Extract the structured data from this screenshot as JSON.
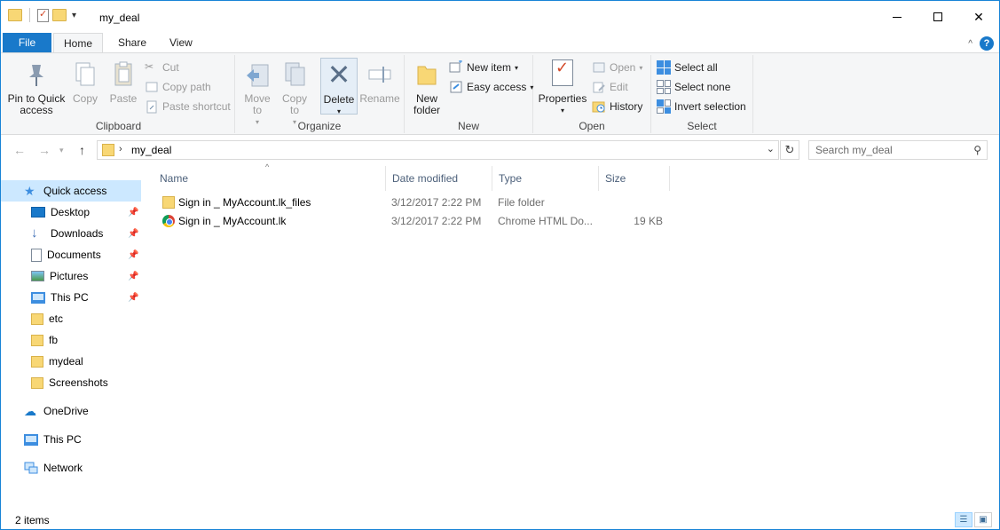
{
  "window": {
    "title": "my_deal"
  },
  "ribbon": {
    "tabs": [
      "File",
      "Home",
      "Share",
      "View"
    ],
    "clipboard": {
      "label": "Clipboard",
      "pin": "Pin to Quick access",
      "copy": "Copy",
      "paste": "Paste",
      "cut": "Cut",
      "copy_path": "Copy path",
      "paste_shortcut": "Paste shortcut"
    },
    "organize": {
      "label": "Organize",
      "move_to": "Move to",
      "copy_to": "Copy to",
      "delete": "Delete",
      "rename": "Rename"
    },
    "new": {
      "label": "New",
      "new_folder": "New folder",
      "new_item": "New item",
      "easy_access": "Easy access"
    },
    "open": {
      "label": "Open",
      "properties": "Properties",
      "open": "Open",
      "edit": "Edit",
      "history": "History"
    },
    "select": {
      "label": "Select",
      "select_all": "Select all",
      "select_none": "Select none",
      "invert_selection": "Invert selection"
    }
  },
  "address": {
    "crumb": "my_deal",
    "search_placeholder": "Search my_deal"
  },
  "navpane": {
    "quick_access": "Quick access",
    "items": [
      {
        "label": "Desktop",
        "icon": "desktop-icon",
        "pinned": true
      },
      {
        "label": "Downloads",
        "icon": "downloads-icon",
        "pinned": true
      },
      {
        "label": "Documents",
        "icon": "documents-icon",
        "pinned": true
      },
      {
        "label": "Pictures",
        "icon": "pictures-icon",
        "pinned": true
      },
      {
        "label": "This PC",
        "icon": "this-pc-icon",
        "pinned": true
      },
      {
        "label": "etc",
        "icon": "folder-icon",
        "pinned": false
      },
      {
        "label": "fb",
        "icon": "folder-icon",
        "pinned": false
      },
      {
        "label": "mydeal",
        "icon": "folder-icon",
        "pinned": false
      },
      {
        "label": "Screenshots",
        "icon": "folder-icon",
        "pinned": false
      }
    ],
    "onedrive": "OneDrive",
    "this_pc": "This PC",
    "network": "Network"
  },
  "files": {
    "columns": [
      "Name",
      "Date modified",
      "Type",
      "Size"
    ],
    "rows": [
      {
        "name": "Sign in _ MyAccount.lk_files",
        "date": "3/12/2017 2:22 PM",
        "type": "File folder",
        "size": "",
        "icon": "folder-icon"
      },
      {
        "name": "Sign in _ MyAccount.lk",
        "date": "3/12/2017 2:22 PM",
        "type": "Chrome HTML Do...",
        "size": "19 KB",
        "icon": "chrome-icon"
      }
    ]
  },
  "status": {
    "count": "2 items"
  },
  "colors": {
    "accent": "#1979ca",
    "selection": "#cce8ff",
    "folder": "#f8d775"
  }
}
